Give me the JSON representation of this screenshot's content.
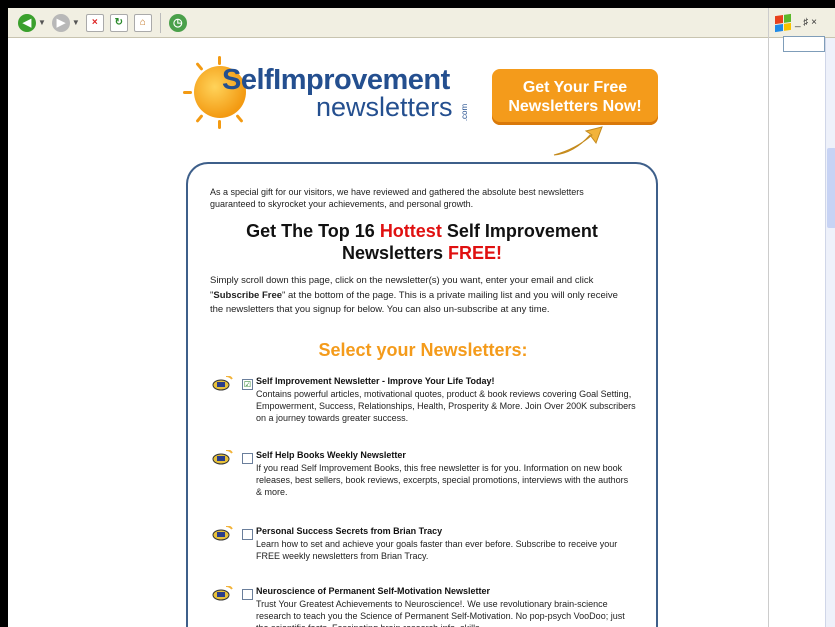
{
  "browser": {
    "toolbar_icons": [
      "back-icon",
      "forward-icon",
      "stop-icon",
      "refresh-icon",
      "home-icon",
      "history-icon"
    ],
    "window_controls": "_ ♯ ×"
  },
  "logo": {
    "line1": "SelfImprovement",
    "line2": "newsletters",
    "suffix": ".com"
  },
  "cta": {
    "line1": "Get Your Free",
    "line2": "Newsletters Now!"
  },
  "intro": "As a special gift for our visitors, we have reviewed and gathered the absolute best newsletters guaranteed to skyrocket your achievements, and personal growth.",
  "headline": {
    "part1": "Get The Top 16 ",
    "highlight1": "Hottest",
    "part2": " Self Improvement Newsletters ",
    "highlight2": "FREE!"
  },
  "instructions": {
    "before": "Simply scroll down this page, click on the newsletter(s) you want, enter your email and click \"",
    "bold": "Subscribe Free",
    "after": "\" at the bottom of the page. This is a private mailing list and you will only receive the newsletters that you signup for below. You can also un-subscribe at any time."
  },
  "select_title": "Select your Newsletters:",
  "newsletters": [
    {
      "title": "Self Improvement Newsletter - Improve Your Life Today!",
      "checked": "☑",
      "description": "Contains powerful articles, motivational quotes, product & book reviews covering Goal Setting, Empowerment, Success, Relationships, Health, Prosperity & More. Join Over 200K subscribers on a journey towards greater success."
    },
    {
      "title": "Self Help Books Weekly Newsletter",
      "checked": "",
      "description": "If you read Self Improvement Books, this free newsletter is for you. Information on new book releases, best sellers, book reviews, excerpts, special promotions, interviews with the authors & more."
    },
    {
      "title": "Personal Success Secrets from Brian Tracy",
      "checked": "",
      "description": "Learn how to set and achieve your goals faster than ever before. Subscribe to receive your FREE weekly newsletters from Brian Tracy."
    },
    {
      "title": "Neuroscience of Permanent Self-Motivation Newsletter",
      "checked": "",
      "description": "Trust Your Greatest Achievements to Neuroscience!. We use revolutionary brain-science research to teach you the Science of Permanent Self-Motivation. No pop-psych VooDoo; just the scientific facts. Fascinating brain research info, skills,"
    }
  ],
  "colors": {
    "accent": "#f49b1b",
    "brand": "#244f8f",
    "highlight": "#e01010",
    "frame": "#3e5f8a"
  }
}
